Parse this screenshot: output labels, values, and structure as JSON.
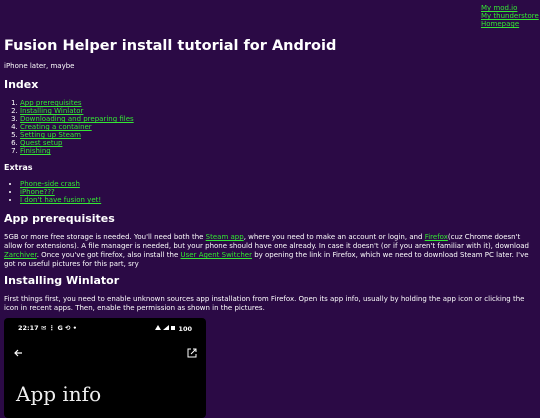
{
  "top_links": [
    "My mod.io",
    "My thunderstore",
    "Homepage"
  ],
  "title": "Fusion Helper install tutorial for Android",
  "subtitle": "iPhone later, maybe",
  "index": {
    "heading": "Index",
    "items": [
      "App prerequisites",
      "Installing Winlator",
      "Downloading and preparing files",
      "Creating a container",
      "Setting up Steam",
      "Quest setup",
      "Finishing"
    ]
  },
  "extras": {
    "heading": "Extras",
    "items": [
      "Phone-side crash",
      "iPhone???",
      "I don't have fusion yet!"
    ]
  },
  "prereq": {
    "heading": "App prerequisites",
    "t1": "5GB or more free storage is needed. You'll need both the ",
    "l1": "Steam app",
    "t2": ", where you need to make an account or login, and ",
    "l2": "Firefox",
    "t3": "(cuz Chrome doesn't allow for extensions). A file manager is needed, but your phone should have one already. In case it doesn't (or if you aren't familiar with it), download ",
    "l3": "Zarchiver",
    "t4": ". Once you've got firefox, also install the ",
    "l4": "User Agent Switcher",
    "t5": " by opening the link in Firefox, which we need to download Steam PC later. I've got no useful pictures for this part, sry"
  },
  "winlator": {
    "heading": "Installing Winlator",
    "text": "First things first, you need to enable unknown sources app installation from Firefox. Open its app info, usually by holding the app icon or clicking the icon in recent apps. Then, enable the permission as shown in the pictures."
  },
  "phone": {
    "time": "22:17",
    "status_icons": "✉ ⋮ G ⟲ •",
    "battery": "100",
    "big_text": "App info"
  }
}
